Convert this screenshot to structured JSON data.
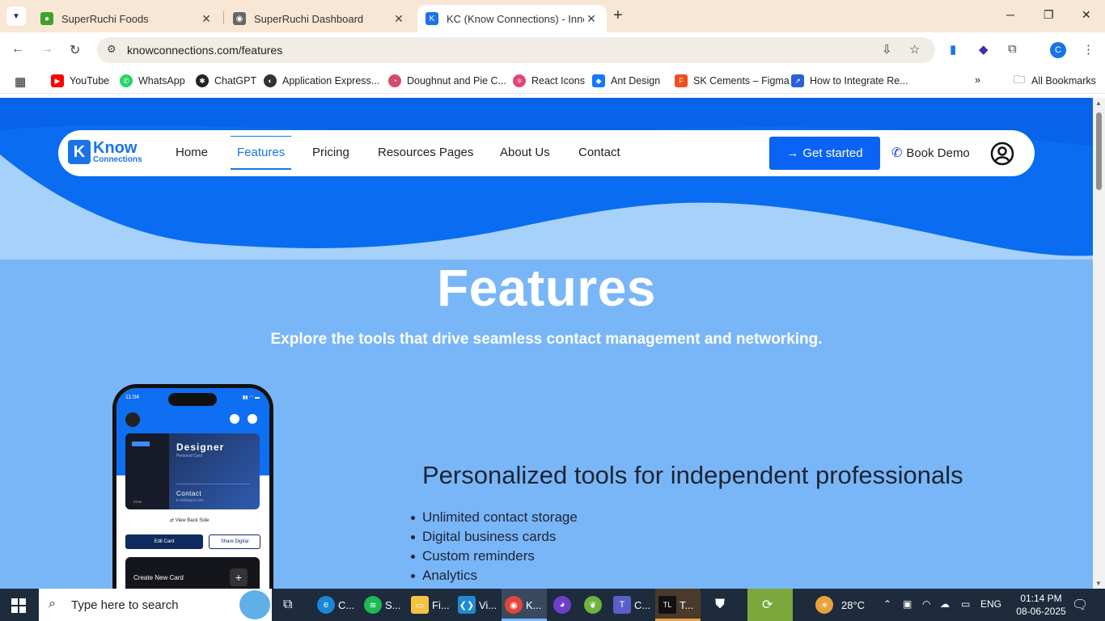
{
  "browser": {
    "tabs": [
      {
        "title": "SuperRuchi Foods",
        "favicon": "green-bowl-icon",
        "color": "#3fa32a"
      },
      {
        "title": "SuperRuchi Dashboard",
        "favicon": "globe-icon",
        "color": "#555555"
      },
      {
        "title": "KC (Know Connections) - Innov",
        "favicon": "kc-logo-icon",
        "color": "#1a74e8"
      }
    ],
    "url": "knowconnections.com/features",
    "profile_initial": "C",
    "bookmarks": [
      {
        "label": "YouTube",
        "icon": "youtube-icon",
        "color": "#ff0000"
      },
      {
        "label": "WhatsApp",
        "icon": "whatsapp-icon",
        "color": "#25d366"
      },
      {
        "label": "ChatGPT",
        "icon": "chatgpt-icon",
        "color": "#222222"
      },
      {
        "label": "Application Express...",
        "icon": "apex-icon",
        "color": "#333333"
      },
      {
        "label": "Doughnut and Pie C...",
        "icon": "chart-icon",
        "color": "#d14b6b"
      },
      {
        "label": "React Icons",
        "icon": "react-icon",
        "color": "#e0457b"
      },
      {
        "label": "Ant Design",
        "icon": "antd-icon",
        "color": "#1677ff"
      },
      {
        "label": "SK Cements – Figma",
        "icon": "figma-icon",
        "color": "#f24e1e"
      },
      {
        "label": "How to Integrate Re...",
        "icon": "bookmark-page-icon",
        "color": "#2b5fd9"
      }
    ],
    "all_bookmarks": "All Bookmarks"
  },
  "site": {
    "logo_line1": "Know",
    "logo_line2": "Connections",
    "nav": [
      "Home",
      "Features",
      "Pricing",
      "Resources Pages",
      "About Us",
      "Contact"
    ],
    "active_nav": "Features",
    "cta_primary": "Get started",
    "cta_secondary": "Book Demo",
    "title": "Features",
    "subtitle": "Explore the tools that drive seamless contact management and networking.",
    "section_heading": "Personalized tools for independent professionals",
    "features": [
      "Unlimited contact storage",
      "Digital business cards",
      "Custom reminders",
      "Analytics"
    ],
    "phone": {
      "time": "11:04",
      "card_title": "Designer",
      "card_subtitle": "Personal Card",
      "card_contact": "Contact",
      "card_contact_sub": "k.m@ingmn.com",
      "card_name": "Kiran",
      "view_back": "View Back Side",
      "edit_card": "Edit Card",
      "share_digital": "Share Digital",
      "create_new": "Create New Card"
    },
    "colors": {
      "brand": "#1a74e8",
      "hero_bg": "#79b6f8",
      "cta": "#0b63f5"
    }
  },
  "taskbar": {
    "search_placeholder": "Type here to search",
    "apps": [
      {
        "label": "C...",
        "icon": "edge-icon",
        "color": "#1b86d6"
      },
      {
        "label": "S...",
        "icon": "spotify-icon",
        "color": "#1db954"
      },
      {
        "label": "Fi...",
        "icon": "file-explorer-icon",
        "color": "#f5c242"
      },
      {
        "label": "Vi...",
        "icon": "vscode-icon",
        "color": "#1f8ad2"
      },
      {
        "label": "K...",
        "icon": "chrome-icon",
        "color": "#e3463a"
      },
      {
        "label": "",
        "icon": "github-icon",
        "color": "#6e40c9"
      },
      {
        "label": "",
        "icon": "spring-icon",
        "color": "#6db33f"
      },
      {
        "label": "C...",
        "icon": "teams-icon",
        "color": "#5b5fc7"
      },
      {
        "label": "T...",
        "icon": "tl-icon",
        "color": "#111111"
      }
    ],
    "weather": "28°C",
    "language": "ENG",
    "time": "01:14 PM",
    "date": "08-06-2025"
  }
}
